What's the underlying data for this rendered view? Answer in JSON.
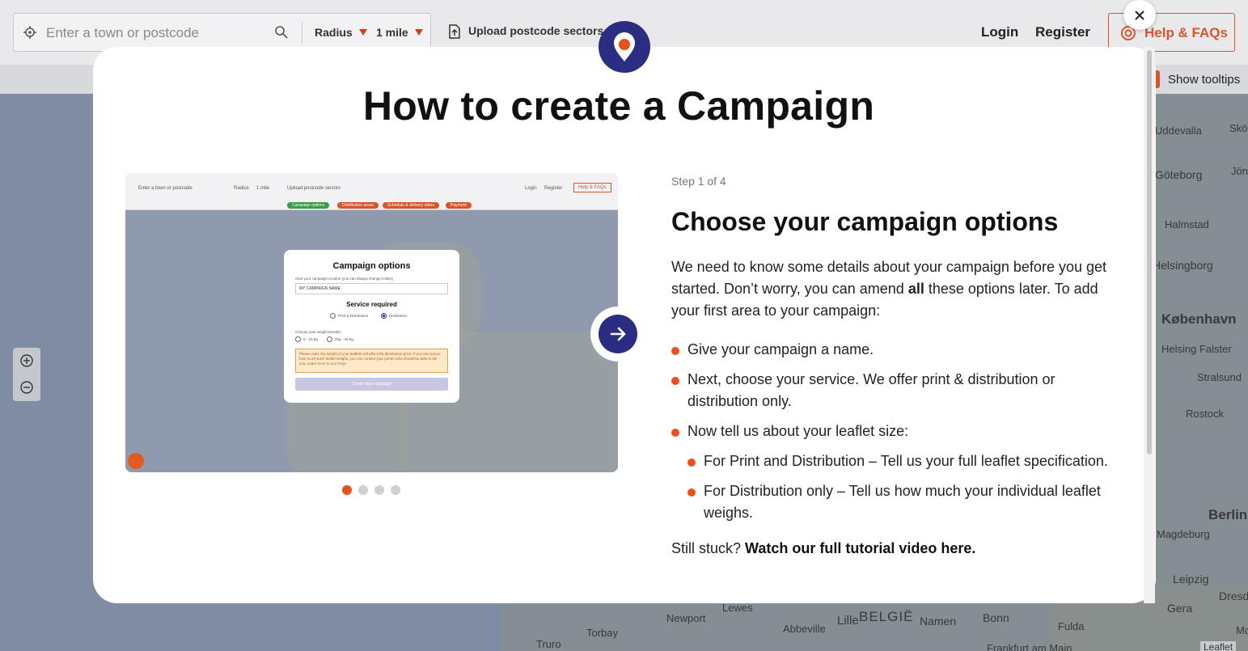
{
  "header": {
    "search_placeholder": "Enter a town or postcode",
    "radius_label": "Radius",
    "radius_value": "1 mile",
    "upload_label": "Upload postcode sectors",
    "login_label": "Login",
    "register_label": "Register",
    "help_label": "Help & FAQs"
  },
  "subbar": {
    "tooltips_label": "Show tooltips"
  },
  "map": {
    "labels": [
      "Uddevalla",
      "Skövde",
      "Göteborg",
      "Jönköping",
      "Halmstad",
      "Helsingborg",
      "København",
      "Helsing Falster",
      "Stralsund",
      "Rostock",
      "Berlin",
      "Magdeburg",
      "Leipzig",
      "Gera",
      "Dresden",
      "Most",
      "Bonn",
      "Namen",
      "Fulda",
      "BELGIË",
      "Lille",
      "Abbeville",
      "Lewes",
      "Newport",
      "Torbay",
      "Truro",
      "Frankfurt am Main"
    ],
    "attribution": "Leaflet"
  },
  "modal": {
    "title": "How to create a Campaign",
    "step_label": "Step 1 of 4",
    "step_title": "Choose your campaign options",
    "intro_1": "We need to know some details about your campaign before you get started. Don’t worry, you can amend ",
    "intro_bold": "all",
    "intro_2": " these options later. To add your first area to your campaign:",
    "bullets": [
      "Give your campaign a name.",
      "Next, choose your service. We offer print & distribution or distribution only.",
      "Now tell us about your leaflet size:"
    ],
    "sub_bullets": [
      "For Print and Distribution – Tell us your full leaflet specification.",
      "For Distribution only – Tell us how much your individual leaflet weighs."
    ],
    "still_text": "Still stuck? ",
    "still_link": "Watch our full tutorial video here.",
    "slides_total": 4,
    "slide_current": 1
  },
  "preview": {
    "search": "Enter a town or postcode",
    "radius": "Radius",
    "mile": "1 mile",
    "upload": "Upload postcode sectors",
    "login": "Login",
    "register": "Register",
    "help": "Help & FAQs",
    "steps": [
      "Campaign options",
      "Distribution areas",
      "Schedule & delivery dates",
      "Payment"
    ],
    "card_title": "Campaign options",
    "name_hint": "Give your campaign a name (you can always change it later)",
    "name_value": "MY CAMPAIGN NAME",
    "service_title": "Service required",
    "service_opt1": "Print & Distribution",
    "service_opt2": "Distribution",
    "weight_hint": "Choose your weight bracket",
    "weight_opt1": "0 - 19.9g",
    "weight_opt2": "20g - 34.9g",
    "warning": "Please note, the weight of your leaflets will affect the distribution price. If you are unsure how much each leaflet weighs, you can contact your printer who should be able to tell you. Learn more in our FAQs",
    "cta": "Create your campaign"
  },
  "colors": {
    "accent": "#e8501c",
    "brand_navy": "#2b2d83"
  }
}
